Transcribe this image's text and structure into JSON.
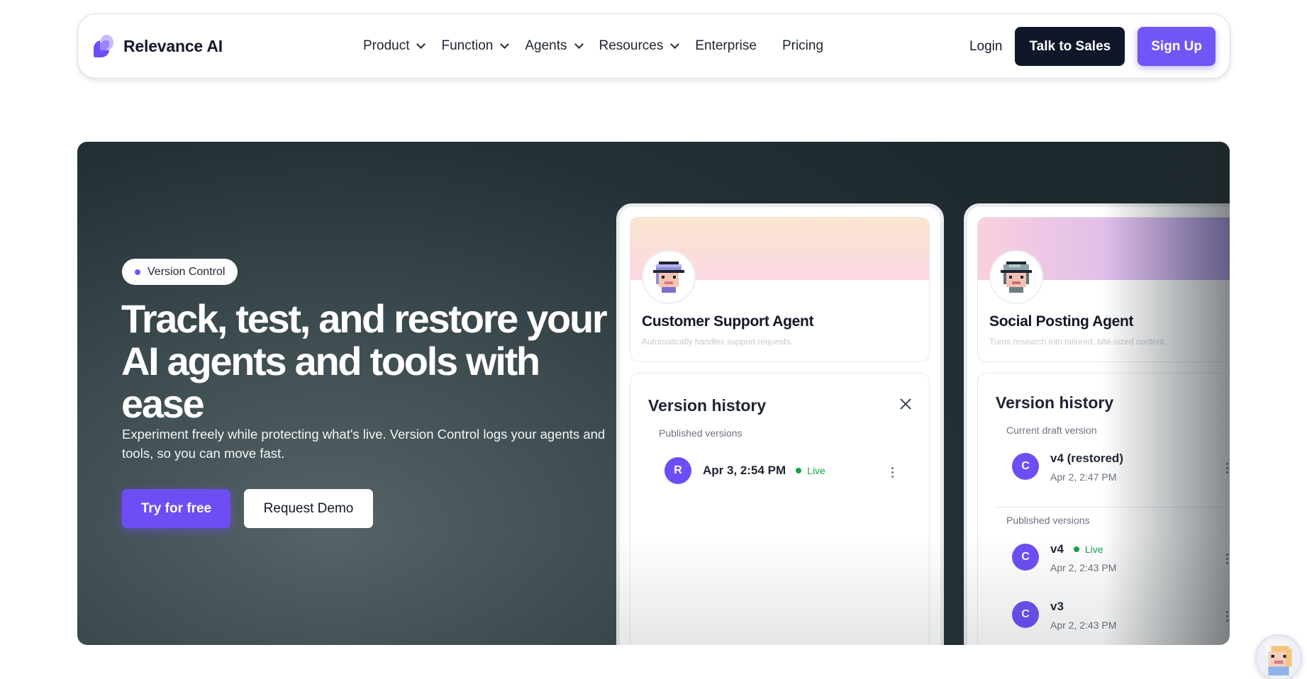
{
  "header": {
    "brand": "Relevance AI",
    "nav": [
      {
        "label": "Product",
        "dropdown": true
      },
      {
        "label": "Function",
        "dropdown": true
      },
      {
        "label": "Agents",
        "dropdown": true
      },
      {
        "label": "Resources",
        "dropdown": true
      },
      {
        "label": "Enterprise",
        "dropdown": false
      },
      {
        "label": "Pricing",
        "dropdown": false
      }
    ],
    "login": "Login",
    "talk_to_sales": "Talk to Sales",
    "sign_up": "Sign Up"
  },
  "hero": {
    "badge": "Version Control",
    "headline": "Track, test, and restore your AI agents and tools with ease",
    "subtext": "Experiment freely while protecting what's live. Version Control logs your agents and tools, so you can move fast.",
    "primary_cta": "Try for free",
    "secondary_cta": "Request Demo"
  },
  "panels": [
    {
      "agent_name": "Customer Support Agent",
      "agent_desc": "Automatically handles support requests.",
      "history_title": "Version history",
      "published_label": "Published versions",
      "published": [
        {
          "initial": "R",
          "label": "Apr 3, 2:54 PM",
          "live": "Live"
        }
      ]
    },
    {
      "agent_name": "Social Posting Agent",
      "agent_desc": "Turns research into tailored, bite-sized content.",
      "history_title": "Version history",
      "draft_label": "Current draft version",
      "draft": {
        "initial": "C",
        "label": "v4 (restored)",
        "date": "Apr 2, 2:47 PM"
      },
      "published_label": "Published versions",
      "published": [
        {
          "initial": "C",
          "label": "v4",
          "live": "Live",
          "date": "Apr 2, 2:43 PM"
        },
        {
          "initial": "C",
          "label": "v3",
          "date": "Apr 2, 2:43 PM"
        }
      ]
    }
  ],
  "colors": {
    "accent": "#6d4ef5",
    "dark_button": "#0f1729",
    "live_green": "#16a34a",
    "hero_bg": "#2b383c"
  },
  "icons": {
    "chevron": "chevron-down-icon",
    "close": "close-icon",
    "more": "kebab-menu-icon",
    "assistant": "assistant-avatar-icon"
  }
}
